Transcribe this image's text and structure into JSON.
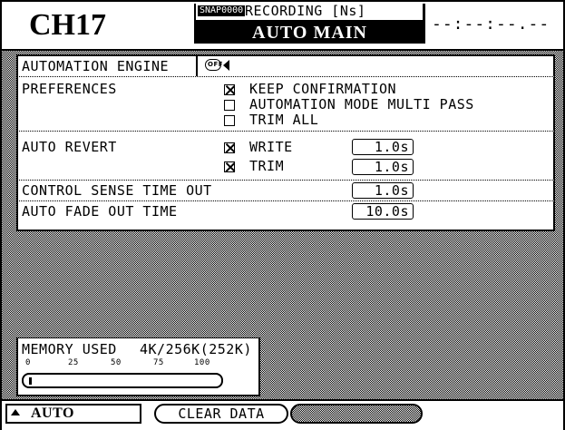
{
  "header": {
    "channel": "CH17",
    "snap_indicator": "SNAP0000",
    "status": "RECORDING [Ns]",
    "screen_title": "AUTO MAIN",
    "timecode": "--:--:--.--"
  },
  "settings": {
    "automation_engine": {
      "label": "AUTOMATION ENGINE",
      "state": "OFF"
    },
    "preferences": {
      "label": "PREFERENCES",
      "options": [
        {
          "label": "KEEP CONFIRMATION",
          "checked": true
        },
        {
          "label": "AUTOMATION MODE MULTI PASS",
          "checked": false
        },
        {
          "label": "TRIM ALL",
          "checked": false
        }
      ]
    },
    "auto_revert": {
      "label": "AUTO REVERT",
      "items": [
        {
          "label": "WRITE",
          "checked": true,
          "value": "1.0s"
        },
        {
          "label": "TRIM",
          "checked": true,
          "value": "1.0s"
        }
      ]
    },
    "control_sense": {
      "label": "CONTROL SENSE TIME OUT",
      "value": "1.0s"
    },
    "auto_fade_out": {
      "label": "AUTO FADE OUT TIME",
      "value": "10.0s"
    }
  },
  "memory": {
    "label": "MEMORY USED",
    "value": "4K/256K(252K)",
    "ticks": [
      "0",
      "25",
      "50",
      "75",
      "100"
    ],
    "used_percent": 1.6
  },
  "footer": {
    "auto_label": "AUTO",
    "clear_label": "CLEAR DATA"
  }
}
